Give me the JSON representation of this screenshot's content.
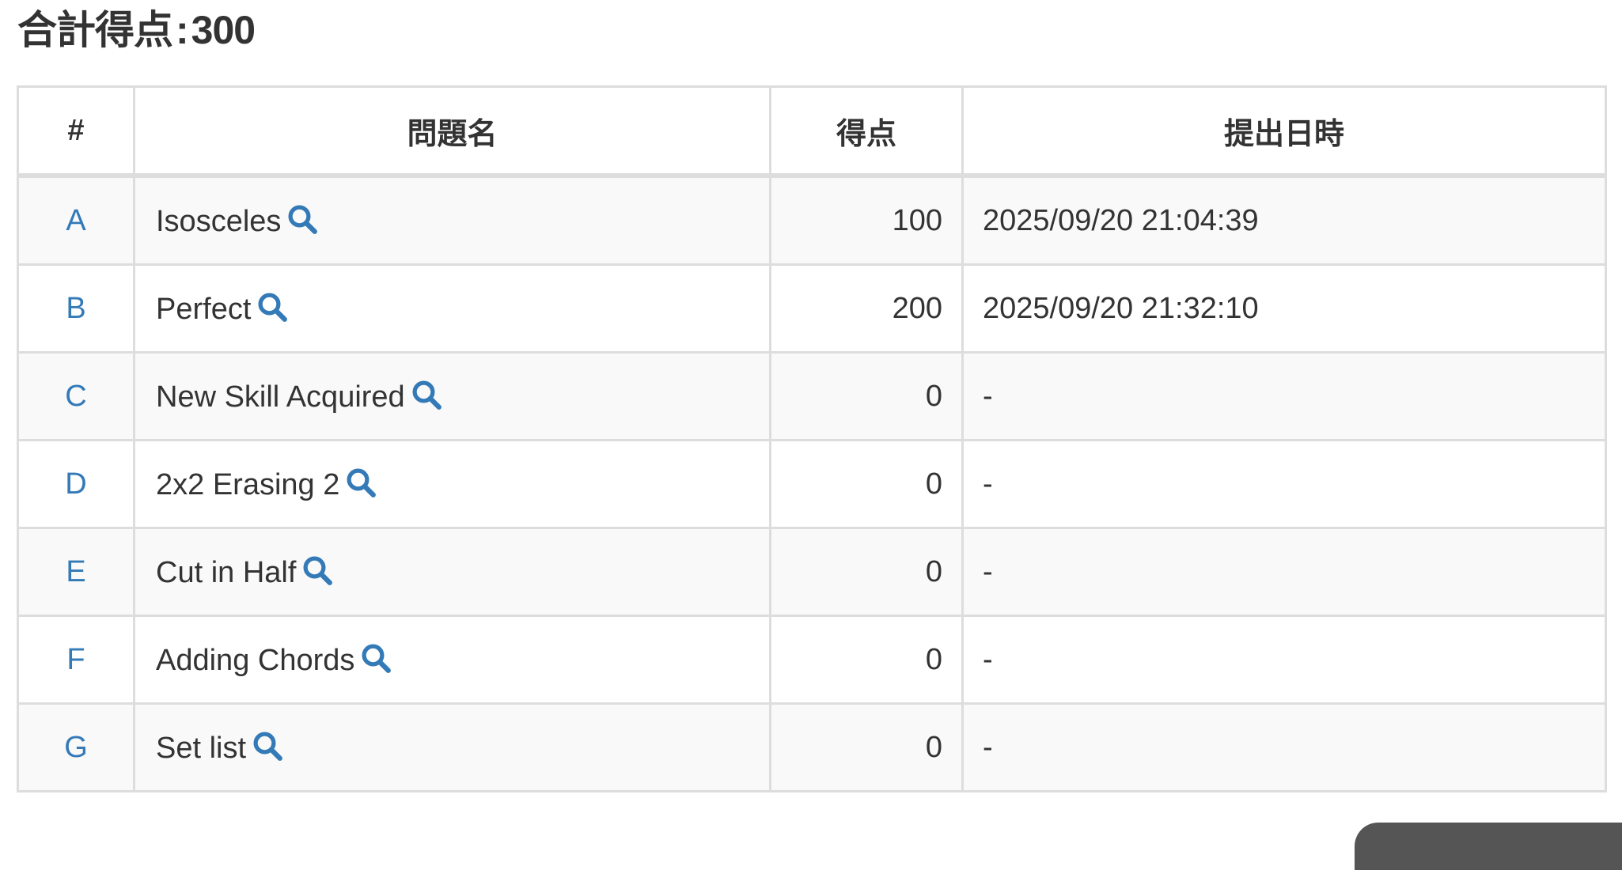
{
  "summary": {
    "label": "合計得点",
    "separator": ":",
    "value": "300"
  },
  "table": {
    "headers": {
      "index": "#",
      "task": "問題名",
      "score": "得点",
      "submitted": "提出日時"
    },
    "rows": [
      {
        "index": "A",
        "task": "Isosceles",
        "score": "100",
        "submitted": "2025/09/20 21:04:39"
      },
      {
        "index": "B",
        "task": "Perfect",
        "score": "200",
        "submitted": "2025/09/20 21:32:10"
      },
      {
        "index": "C",
        "task": "New Skill Acquired",
        "score": "0",
        "submitted": "-"
      },
      {
        "index": "D",
        "task": "2x2 Erasing 2",
        "score": "0",
        "submitted": "-"
      },
      {
        "index": "E",
        "task": "Cut in Half",
        "score": "0",
        "submitted": "-"
      },
      {
        "index": "F",
        "task": "Adding Chords",
        "score": "0",
        "submitted": "-"
      },
      {
        "index": "G",
        "task": "Set list",
        "score": "0",
        "submitted": "-"
      }
    ]
  },
  "icons": {
    "search": "search-icon"
  },
  "colors": {
    "link": "#337ab7",
    "text": "#333333",
    "border": "#dddddd",
    "row_stripe": "#f9f9f9"
  }
}
